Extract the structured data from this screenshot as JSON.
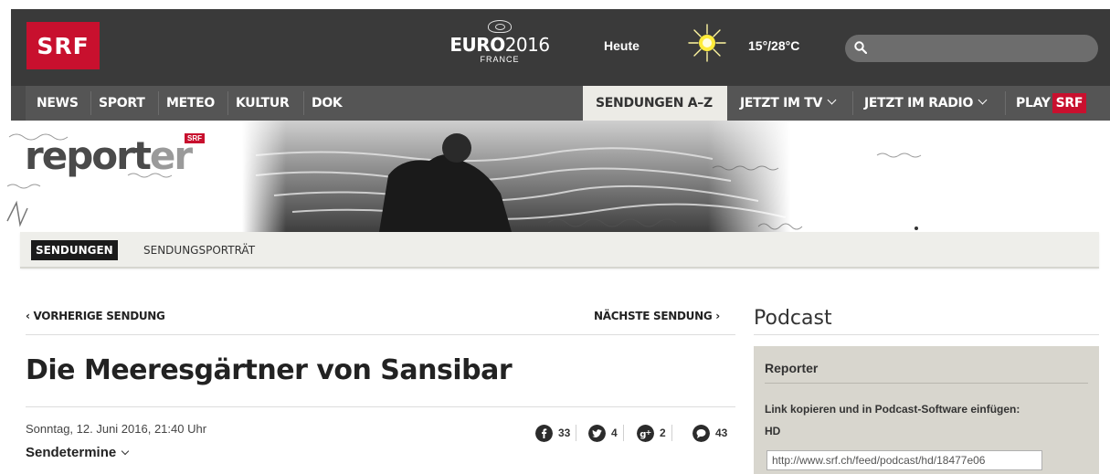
{
  "header": {
    "logo_text": "SRF",
    "euro": {
      "brand": "EURO",
      "year": "2016",
      "country": "FRANCE"
    },
    "weather": {
      "day": "Heute",
      "temperature": "15°/28°C",
      "icon": "sun-icon"
    },
    "search": {
      "placeholder": "",
      "value": ""
    }
  },
  "nav": {
    "left_items": [
      {
        "label": "NEWS"
      },
      {
        "label": "SPORT"
      },
      {
        "label": "METEO"
      },
      {
        "label": "KULTUR"
      },
      {
        "label": "DOK"
      }
    ],
    "active_item": "SENDUNGEN A–Z",
    "tv": "JETZT IM TV",
    "radio": "JETZT IM RADIO",
    "play": "PLAY",
    "play_badge": "SRF"
  },
  "banner": {
    "show_logo_main": "report",
    "show_logo_suffix": "er",
    "show_logo_badge": "SRF"
  },
  "subnav": {
    "active": "SENDUNGEN",
    "item": "SENDUNGSPORTRÄT"
  },
  "article": {
    "prev": "‹ VORHERIGE SENDUNG",
    "next": "NÄCHSTE SENDUNG ›",
    "title": "Die Meeresgärtner von Sansibar",
    "date": "Sonntag, 12. Juni 2016, 21:40 Uhr",
    "sendetermine": "Sendetermine",
    "social": [
      {
        "icon": "facebook-icon",
        "count": "33"
      },
      {
        "icon": "twitter-icon",
        "count": "4"
      },
      {
        "icon": "google-plus-icon",
        "count": "2"
      },
      {
        "icon": "comments-icon",
        "count": "43"
      }
    ]
  },
  "podcast": {
    "heading": "Podcast",
    "box_title": "Reporter",
    "instructions": "Link kopieren und in Podcast-Software einfügen:",
    "quality": "HD",
    "url": "http://www.srf.ch/feed/podcast/hd/18477e06"
  },
  "colors": {
    "brand_red": "#c8102e",
    "topbar": "#3a3a3a",
    "nav": "#555555",
    "podcast_box": "#d8d6ce"
  }
}
